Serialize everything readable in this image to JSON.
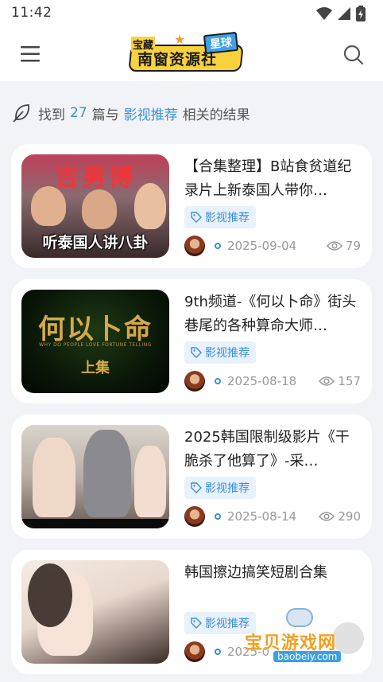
{
  "status_bar": {
    "time": "11:42"
  },
  "header": {
    "logo_main": "南窗资源社",
    "logo_tag_left": "宝藏",
    "logo_tag_right": "星球"
  },
  "search_result": {
    "prefix": "找到",
    "count": "27",
    "middle": "篇与",
    "keyword": "影视推荐",
    "suffix": "相关的结果"
  },
  "posts": [
    {
      "title": "【合集整理】B站食贫道纪录片上新泰国人带你…",
      "thumb_caption": "听泰国人讲八卦",
      "thumb_top_text": "吉男博",
      "tag": "影视推荐",
      "date": "2025-09-04",
      "views": "79"
    },
    {
      "title": "9th频道-《何以卜命》街头巷尾的各种算命大师…",
      "thumb_caption": "上集",
      "thumb_top_text": "何以卜命",
      "thumb_sub_text": "WHY DO PEOPLE LOVE FORTUNE TELLING",
      "tag": "影视推荐",
      "date": "2025-08-18",
      "views": "157"
    },
    {
      "title": "2025韩国限制级影片《干脆杀了他算了》-采…",
      "tag": "影视推荐",
      "date": "2025-08-14",
      "views": "290"
    },
    {
      "title": "韩国擦边搞笑短剧合集",
      "tag": "影视推荐",
      "date": "2025-0",
      "views": ""
    }
  ],
  "watermark": {
    "text": "宝贝游戏网",
    "sub": "baobeiy.com"
  },
  "colors": {
    "accent": "#3b8fd8",
    "background": "#f2f3f6",
    "tag_bg": "#e8f2fc"
  },
  "icons": [
    "menu-icon",
    "search-icon",
    "feather-icon",
    "tag-icon",
    "eye-icon",
    "wifi-icon",
    "signal-icon",
    "battery-icon"
  ]
}
